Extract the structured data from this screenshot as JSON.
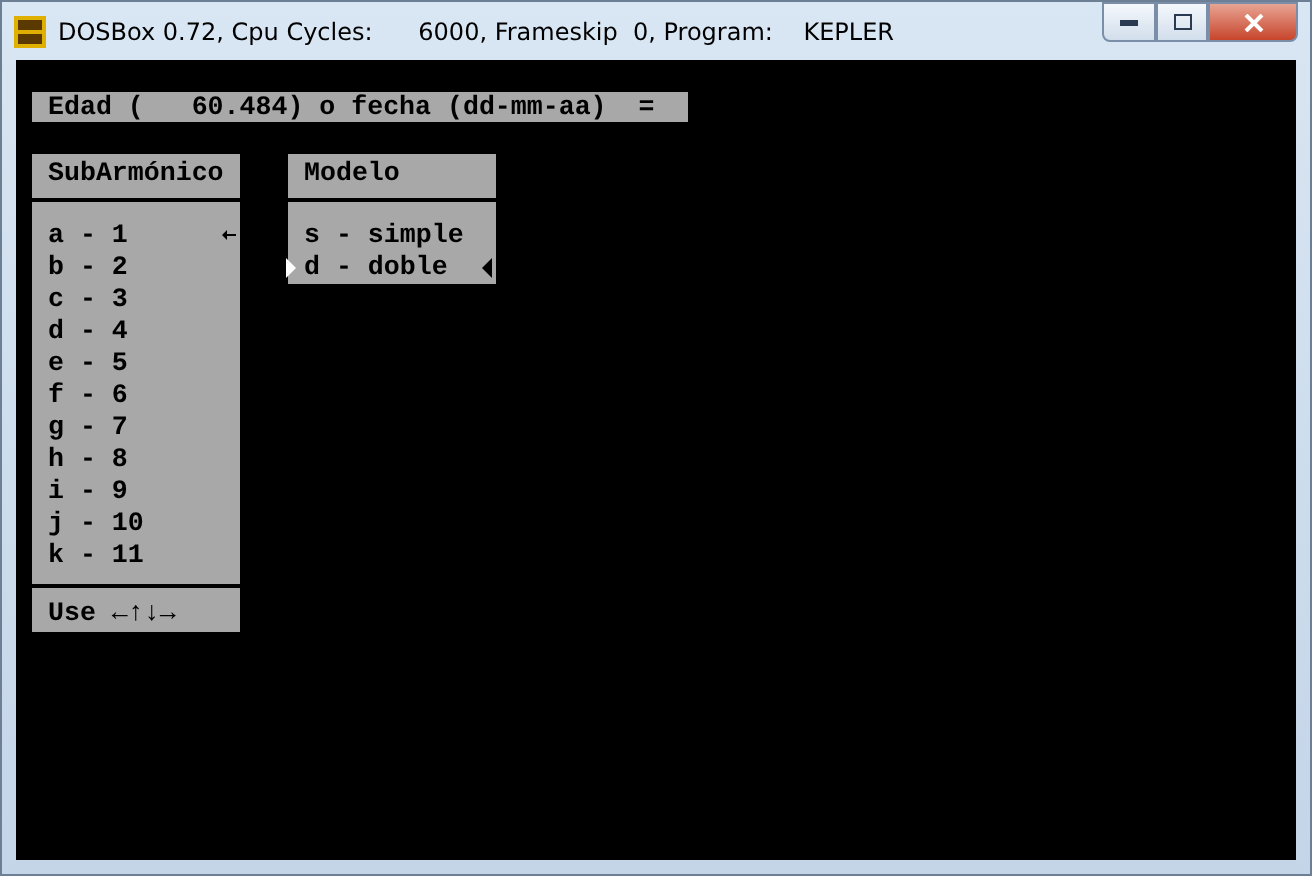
{
  "window": {
    "title": "DOSBox 0.72, Cpu Cycles:      6000, Frameskip  0, Program:    KEPLER"
  },
  "prompt": {
    "text": "Edad (   60.484) o fecha (dd-mm-aa)  ="
  },
  "subarmonico": {
    "title": "SubArmónico",
    "items": [
      {
        "label": "a - 1",
        "selected": true
      },
      {
        "label": "b - 2",
        "selected": false
      },
      {
        "label": "c - 3",
        "selected": false
      },
      {
        "label": "d - 4",
        "selected": false
      },
      {
        "label": "e - 5",
        "selected": false
      },
      {
        "label": "f - 6",
        "selected": false
      },
      {
        "label": "g - 7",
        "selected": false
      },
      {
        "label": "h - 8",
        "selected": false
      },
      {
        "label": "i - 9",
        "selected": false
      },
      {
        "label": "j - 10",
        "selected": false
      },
      {
        "label": "k - 11",
        "selected": false
      }
    ],
    "footer": "Use ←↑↓→"
  },
  "modelo": {
    "title": "Modelo",
    "items": [
      {
        "label": "s - simple",
        "selected": false
      },
      {
        "label": "d - doble",
        "selected": true
      }
    ]
  }
}
